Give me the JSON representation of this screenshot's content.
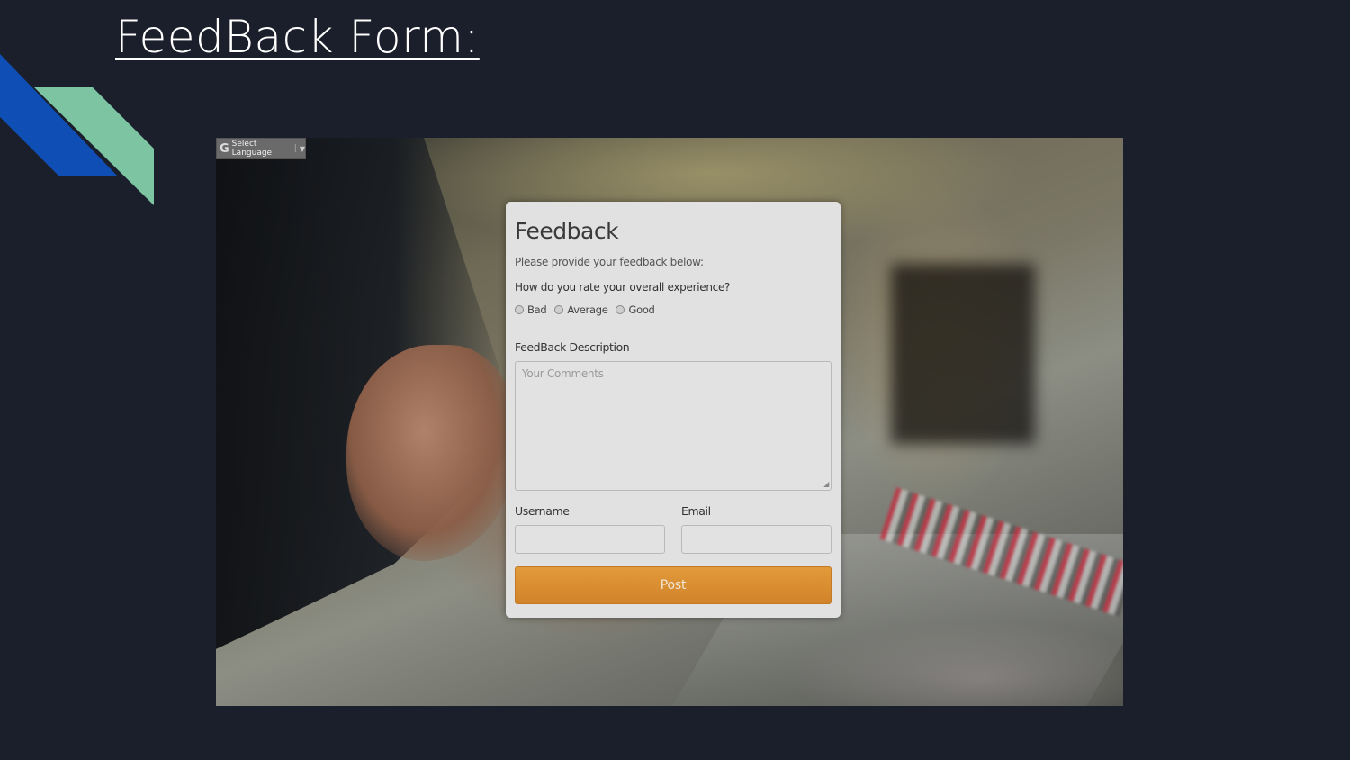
{
  "slide": {
    "title": "FeedBack Form:"
  },
  "translate_widget": {
    "logo": "G",
    "label": "Select Language",
    "arrow_icon": "chevron-down-icon"
  },
  "form": {
    "title": "Feedback",
    "subtitle": "Please provide your feedback below:",
    "rating_question": "How do you rate your overall experience?",
    "rating_options": [
      "Bad",
      "Average",
      "Good"
    ],
    "description_label": "FeedBack Description",
    "description_placeholder": "Your Comments",
    "username_label": "Username",
    "email_label": "Email",
    "username_value": "",
    "email_value": "",
    "submit_label": "Post"
  },
  "colors": {
    "slide_background": "#1b1f2b",
    "deco_blue": "#0f4fb5",
    "deco_green": "#7cc4a2",
    "card_background": "#e1e1e1",
    "button_orange": "#d98b30"
  }
}
